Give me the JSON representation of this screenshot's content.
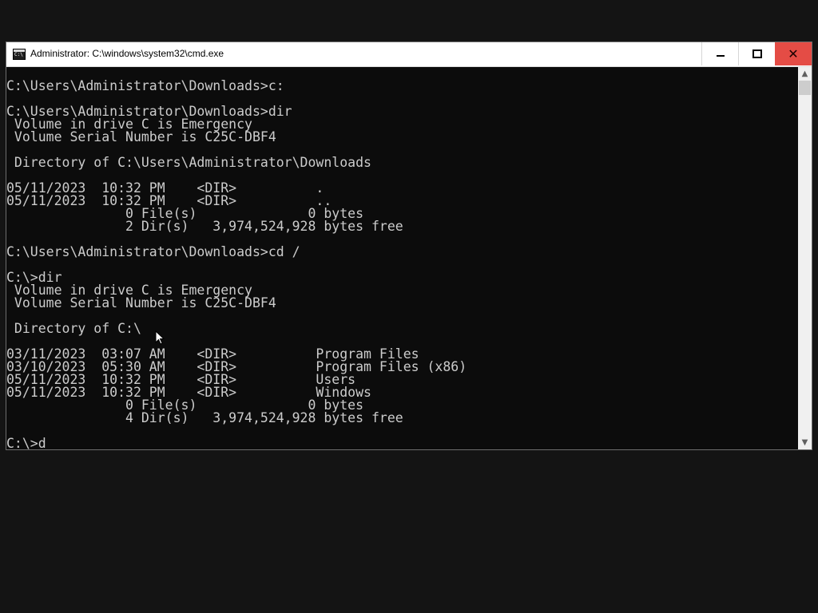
{
  "window": {
    "title": "Administrator: C:\\windows\\system32\\cmd.exe",
    "icon": "cmd-icon",
    "controls": {
      "minimize_icon": "minimize-icon",
      "maximize_icon": "maximize-icon",
      "close_icon": "close-icon",
      "close_color": "#e44c45"
    }
  },
  "console": {
    "background": "#0c0c0c",
    "foreground": "#cccccc",
    "lines": [
      "C:\\Users\\Administrator\\Downloads>c:",
      "",
      "C:\\Users\\Administrator\\Downloads>dir",
      " Volume in drive C is Emergency",
      " Volume Serial Number is C25C-DBF4",
      "",
      " Directory of C:\\Users\\Administrator\\Downloads",
      "",
      "05/11/2023  10:32 PM    <DIR>          .",
      "05/11/2023  10:32 PM    <DIR>          ..",
      "               0 File(s)              0 bytes",
      "               2 Dir(s)   3,974,524,928 bytes free",
      "",
      "C:\\Users\\Administrator\\Downloads>cd /",
      "",
      "C:\\>dir",
      " Volume in drive C is Emergency",
      " Volume Serial Number is C25C-DBF4",
      "",
      " Directory of C:\\",
      "",
      "03/11/2023  03:07 AM    <DIR>          Program Files",
      "03/10/2023  05:30 AM    <DIR>          Program Files (x86)",
      "05/11/2023  10:32 PM    <DIR>          Users",
      "05/11/2023  10:32 PM    <DIR>          Windows",
      "               0 File(s)              0 bytes",
      "               4 Dir(s)   3,974,524,928 bytes free",
      "",
      "C:\\>d"
    ]
  },
  "scrollbar": {
    "up_icon": "scroll-up-arrow-icon",
    "down_icon": "scroll-down-arrow-icon"
  }
}
